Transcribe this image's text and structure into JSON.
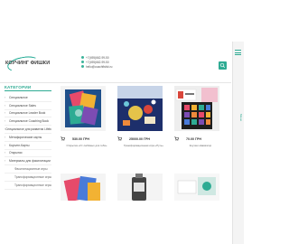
{
  "header": {
    "logo_text": "КОУЧИНГ ФИШКИ",
    "phone1": "+7(495)662-99-50",
    "phone2": "+7(495)662-99-50",
    "email": "hello@coachfishki.ru"
  },
  "sidebar": {
    "title": "КАТЕГОРИИ",
    "items": [
      {
        "label": "Специальное",
        "sub": false
      },
      {
        "label": "Специальное Sales",
        "sub": false
      },
      {
        "label": "Специальное Leader Book",
        "sub": false
      },
      {
        "label": "Специальное Coaching Book",
        "sub": false
      },
      {
        "label": "Специальное для развития Lifebook",
        "sub": false
      },
      {
        "label": "Метафорические карты",
        "sub": false
      },
      {
        "label": "Коучинг-Карты",
        "sub": false
      },
      {
        "label": "Открытки",
        "sub": false
      },
      {
        "label": "Материалы для фасилитации",
        "sub": false
      },
      {
        "label": "Фасилитационные игры",
        "sub": true
      },
      {
        "label": "Трансформационные игры",
        "sub": true
      },
      {
        "label": "Трансформационные игры",
        "sub": true
      }
    ]
  },
  "products": [
    {
      "price": "530.00 ГРН",
      "title": "Открытка «От любимых для тебя»"
    },
    {
      "price": "25000.00 ГРН",
      "title": "Трансформационная игра «Путь»"
    },
    {
      "price": "70.00 ГРН",
      "title": "Коучинг-Навигатор"
    }
  ],
  "right_bar": {
    "label": "Меню"
  },
  "colors": {
    "accent": "#2eab93"
  }
}
